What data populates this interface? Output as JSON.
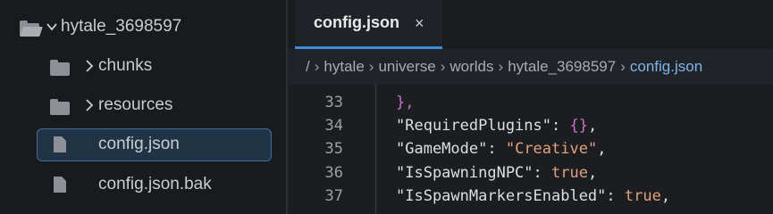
{
  "explorer": {
    "root": {
      "label": "hytale_3698597",
      "expanded": true
    },
    "items": [
      {
        "label": "chunks",
        "type": "folder",
        "expanded": false
      },
      {
        "label": "resources",
        "type": "folder",
        "expanded": false
      },
      {
        "label": "config.json",
        "type": "file",
        "selected": true
      },
      {
        "label": "config.json.bak",
        "type": "file",
        "selected": false
      }
    ]
  },
  "tab": {
    "label": "config.json",
    "close": "×"
  },
  "breadcrumb": {
    "items": [
      "/",
      "hytale",
      "universe",
      "worlds",
      "hytale_3698597",
      "config.json"
    ]
  },
  "editor": {
    "lines": [
      {
        "number": "33",
        "tokens": [
          {
            "text": "},",
            "kind": "b"
          }
        ]
      },
      {
        "number": "34",
        "tokens": [
          {
            "text": "\"RequiredPlugins\"",
            "kind": "k"
          },
          {
            "text": ": ",
            "kind": "p"
          },
          {
            "text": "{}",
            "kind": "b"
          },
          {
            "text": ",",
            "kind": "p"
          }
        ]
      },
      {
        "number": "35",
        "tokens": [
          {
            "text": "\"GameMode\"",
            "kind": "k"
          },
          {
            "text": ": ",
            "kind": "p"
          },
          {
            "text": "\"Creative\"",
            "kind": "s"
          },
          {
            "text": ",",
            "kind": "p"
          }
        ]
      },
      {
        "number": "36",
        "tokens": [
          {
            "text": "\"IsSpawningNPC\"",
            "kind": "k"
          },
          {
            "text": ": ",
            "kind": "p"
          },
          {
            "text": "true",
            "kind": "s"
          },
          {
            "text": ",",
            "kind": "p"
          }
        ]
      },
      {
        "number": "37",
        "tokens": [
          {
            "text": "\"IsSpawnMarkersEnabled\"",
            "kind": "k"
          },
          {
            "text": ": ",
            "kind": "p"
          },
          {
            "text": "true",
            "kind": "s"
          },
          {
            "text": ",",
            "kind": "p"
          }
        ]
      }
    ]
  },
  "colors": {
    "accent": "#3b8fd9",
    "selection": "#213446",
    "string": "#e0a27c",
    "bracket": "#c971c9"
  }
}
